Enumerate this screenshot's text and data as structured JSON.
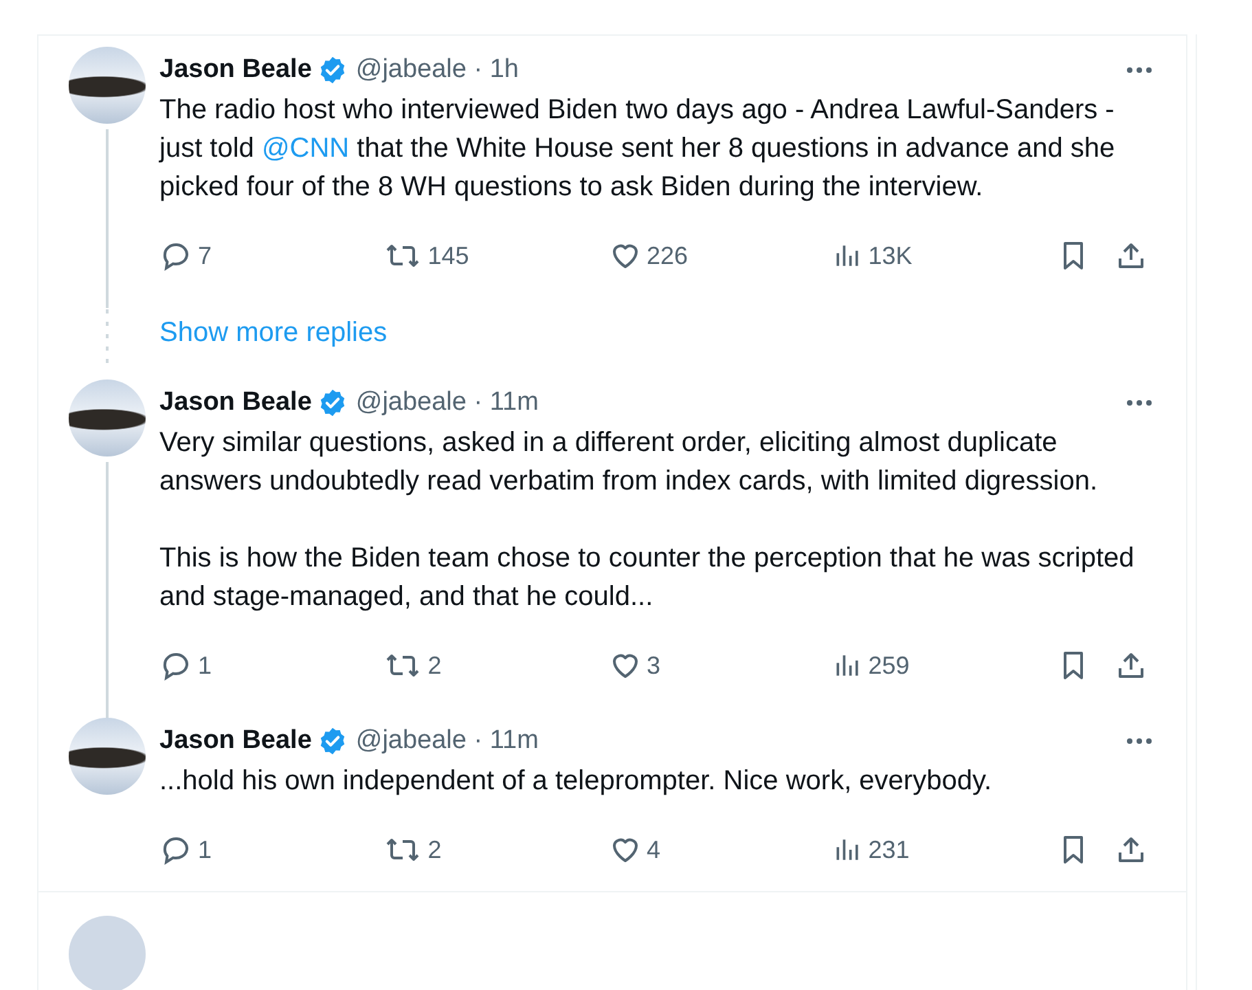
{
  "tweets": [
    {
      "name": "Jason Beale",
      "verified": true,
      "meta": "@jabeale · 1h",
      "connected": true,
      "paragraphs": [
        [
          {
            "kind": "text",
            "text": "The radio host who interviewed Biden two days ago - Andrea Lawful-Sanders - just told "
          },
          {
            "kind": "link",
            "text": "@CNN"
          },
          {
            "kind": "text",
            "text": " that the White House sent her 8 questions in advance and she picked four of the 8 WH questions to ask Biden during the interview."
          }
        ]
      ],
      "replies": "7",
      "reposts": "145",
      "likes": "226",
      "views": "13K"
    },
    {
      "kind": "more",
      "label": "Show more replies"
    },
    {
      "name": "Jason Beale",
      "verified": true,
      "meta": "@jabeale · 11m",
      "connected": true,
      "paragraphs": [
        [
          {
            "kind": "text",
            "text": "Very similar questions, asked in a different order, eliciting almost duplicate answers undoubtedly read verbatim from index cards, with limited digression."
          }
        ],
        [
          {
            "kind": "text",
            "text": "This is how the Biden team chose to counter the perception that he was scripted and stage-managed, and that he could..."
          }
        ]
      ],
      "replies": "1",
      "reposts": "2",
      "likes": "3",
      "views": "259"
    },
    {
      "name": "Jason Beale",
      "verified": true,
      "meta": "@jabeale · 11m",
      "connected": false,
      "paragraphs": [
        [
          {
            "kind": "text",
            "text": "...hold his own independent of a teleprompter. Nice work, everybody."
          }
        ]
      ],
      "replies": "1",
      "reposts": "2",
      "likes": "4",
      "views": "231"
    }
  ]
}
